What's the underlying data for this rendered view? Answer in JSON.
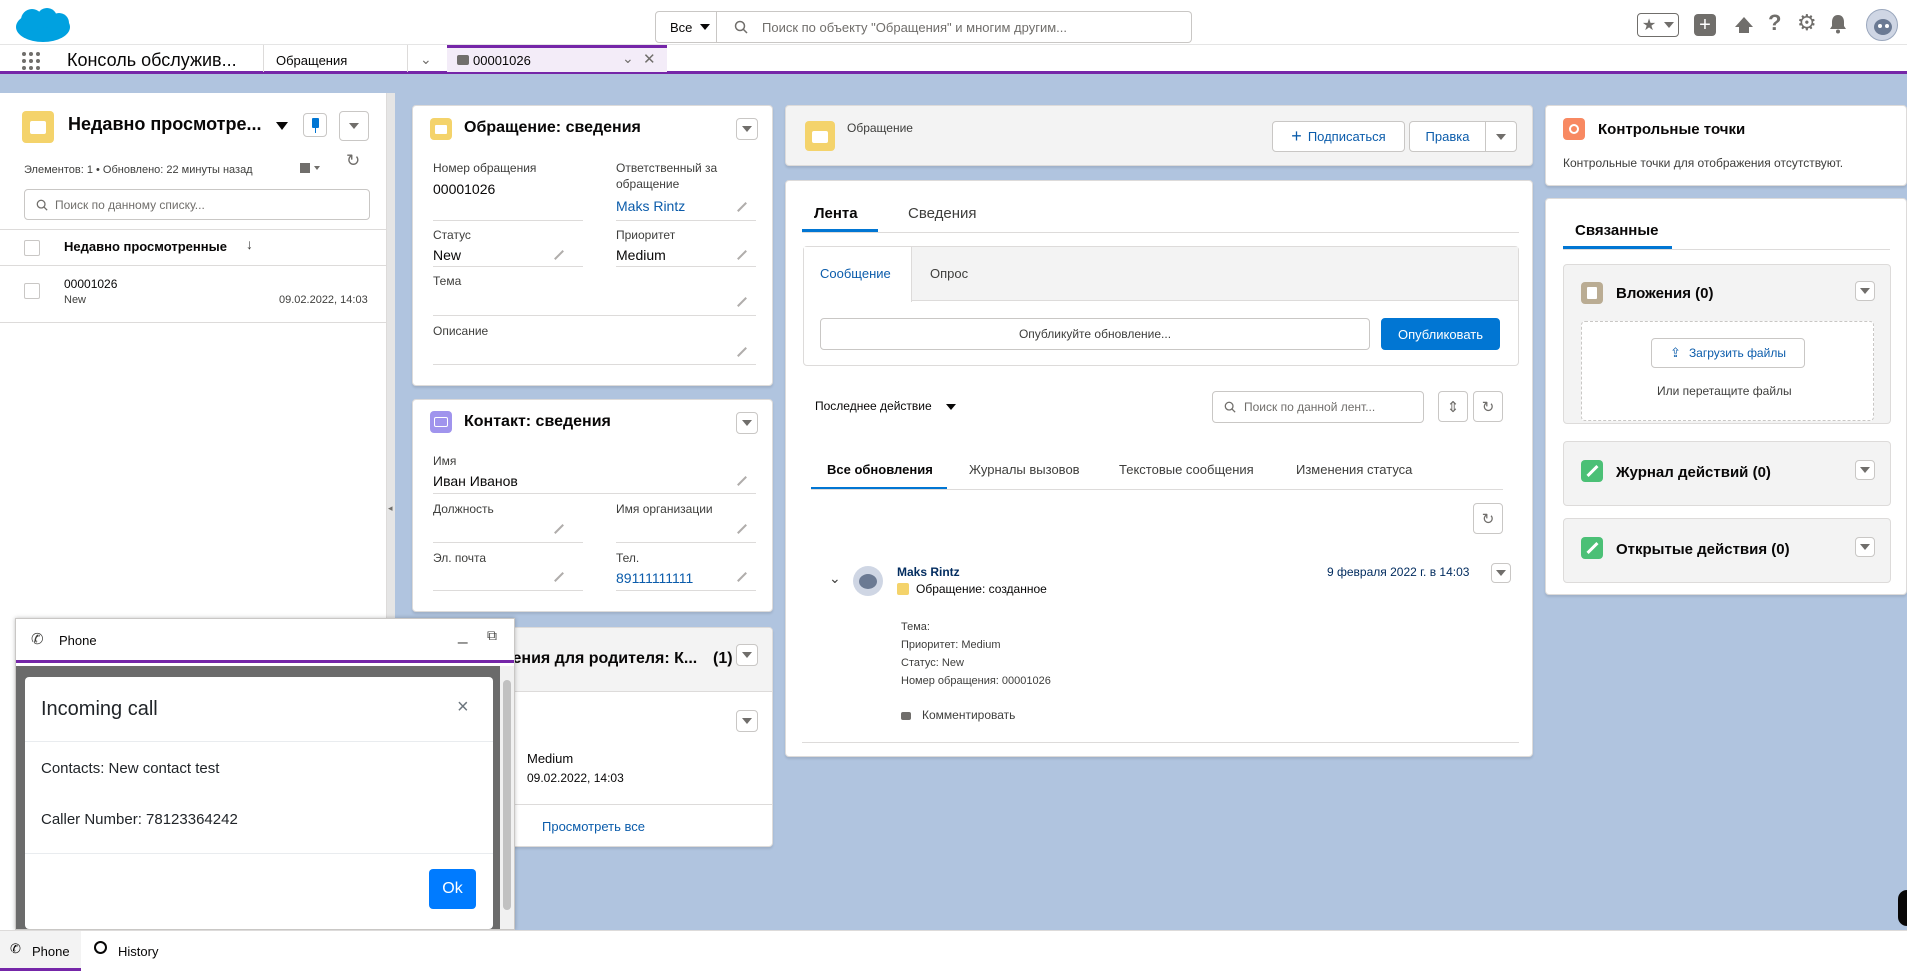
{
  "header": {
    "search_scope": "Все",
    "search_placeholder": "Поиск по объекту \"Обращения\" и многим другим..."
  },
  "nav": {
    "app_name": "Консоль обслужив...",
    "tab_object": "Обращения",
    "tab_record": "00001026"
  },
  "list_panel": {
    "title": "Недавно просмотре...",
    "meta": "Элементов: 1 • Обновлено: 22 минуты назад",
    "search_placeholder": "Поиск по данному списку...",
    "column": "Недавно просмотренные",
    "row_number": "00001026",
    "row_status": "New",
    "row_date": "09.02.2022, 14:03"
  },
  "case_details": {
    "title": "Обращение: сведения",
    "number_label": "Номер обращения",
    "number_value": "00001026",
    "owner_label_1": "Ответственный за",
    "owner_label_2": "обращение",
    "owner_value": "Maks Rintz",
    "status_label": "Статус",
    "status_value": "New",
    "priority_label": "Приоритет",
    "priority_value": "Medium",
    "subject_label": "Тема",
    "description_label": "Описание"
  },
  "contact_details": {
    "title": "Контакт: сведения",
    "name_label": "Имя",
    "name_value": "Иван Иванов",
    "position_label": "Должность",
    "org_label": "Имя организации",
    "email_label": "Эл. почта",
    "phone_label": "Тел.",
    "phone_value": "89111111111"
  },
  "related_cases": {
    "title": "щения для родителя: К...",
    "count": "(1)",
    "priority": "Medium",
    "date": "09.02.2022, 14:03",
    "view_all": "Просмотреть все"
  },
  "record_header": {
    "label": "Обращение",
    "subscribe": "Подписаться",
    "edit": "Правка"
  },
  "feed": {
    "tab_feed": "Лента",
    "tab_details": "Сведения",
    "subtab_message": "Сообщение",
    "subtab_poll": "Опрос",
    "post_placeholder": "Опубликуйте обновление...",
    "post_button": "Опубликовать",
    "sort": "Последнее действие",
    "search_placeholder": "Поиск по данной лент...",
    "filter_all": "Все обновления",
    "filter_calls": "Журналы вызовов",
    "filter_sms": "Текстовые сообщения",
    "filter_status": "Изменения статуса",
    "item_author": "Maks Rintz",
    "item_action": "Обращение: созданное",
    "item_date": "9 февраля 2022 г. в 14:03",
    "item_line1": "Тема:",
    "item_line2": "Приоритет: Medium",
    "item_line3": "Статус: New",
    "item_line4": "Номер обращения: 00001026",
    "comment": "Комментировать"
  },
  "milestones": {
    "title": "Контрольные точки",
    "empty": "Контрольные точки для отображения отсутствуют."
  },
  "related": {
    "tab": "Связанные",
    "attachments": "Вложения (0)",
    "upload": "Загрузить файлы",
    "drop": "Или перетащите файлы",
    "activity_log": "Журнал действий (0)",
    "open_activities": "Открытые действия (0)"
  },
  "phone": {
    "title": "Phone",
    "modal_title": "Incoming call",
    "contacts": "Contacts: New contact test",
    "caller": "Caller Number: 78123364242",
    "ok": "Ok"
  },
  "utility": {
    "phone": "Phone",
    "history": "History"
  },
  "colors": {
    "brand": "#0176d3",
    "case_icon": "#f4d36b",
    "contact_icon": "#a094ed",
    "milestone_icon": "#f88962",
    "attachment_icon": "#baac93",
    "activity_icon": "#4bc076"
  }
}
